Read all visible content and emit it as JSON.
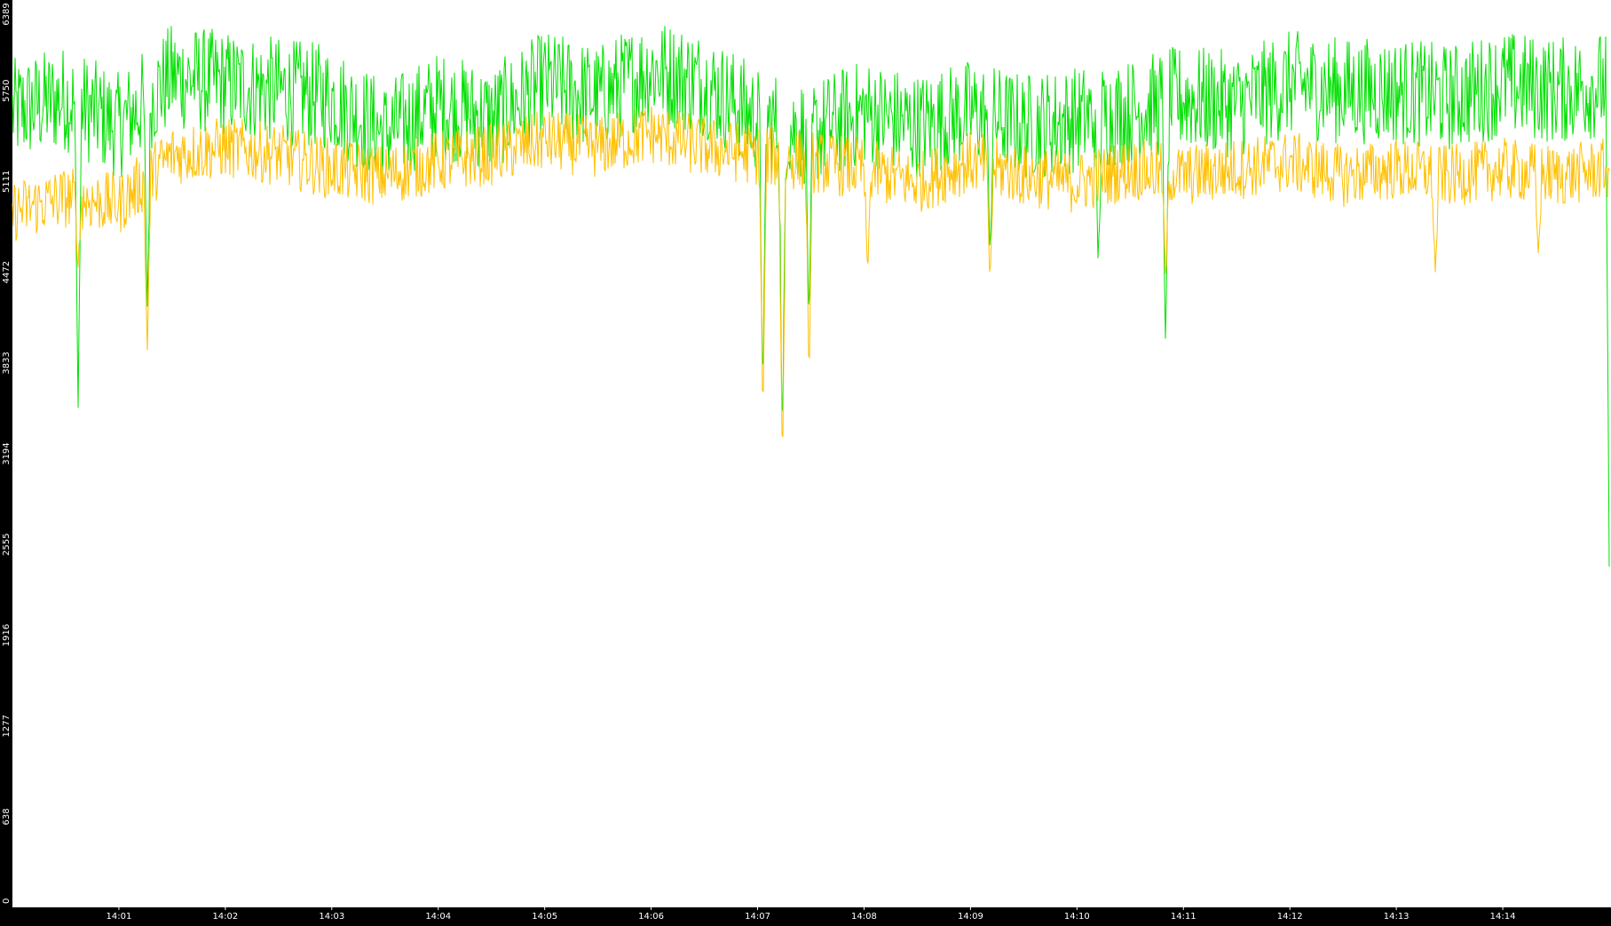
{
  "colors": {
    "background": "#000000",
    "plot_area": "#ffffff",
    "text": "#ffffff",
    "series_green": "#00e000",
    "series_orange": "#ffc000"
  },
  "chart_data": {
    "type": "line",
    "title": "",
    "xlabel": "",
    "ylabel": "",
    "grid": false,
    "legend": "none",
    "ylim": [
      0,
      6389
    ],
    "xlim": [
      "14:00",
      "14:15"
    ],
    "y_ticks": [
      0,
      638,
      1277,
      1916,
      2555,
      3194,
      3833,
      4472,
      5111,
      5750,
      6389
    ],
    "x_ticks": [
      "14:01",
      "14:02",
      "14:03",
      "14:04",
      "14:05",
      "14:06",
      "14:07",
      "14:08",
      "14:09",
      "14:10",
      "14:11",
      "14:12",
      "14:13",
      "14:14"
    ],
    "series": [
      {
        "color": "#00e000",
        "x": [
          "14:00:00",
          "14:00:30",
          "14:01:00",
          "14:01:30",
          "14:02:00",
          "14:02:30",
          "14:03:00",
          "14:03:30",
          "14:04:00",
          "14:04:30",
          "14:05:00",
          "14:05:30",
          "14:06:00",
          "14:06:30",
          "14:07:00",
          "14:07:30",
          "14:08:00",
          "14:08:30",
          "14:09:00",
          "14:09:30",
          "14:10:00",
          "14:10:30",
          "14:11:00",
          "14:11:30",
          "14:12:00",
          "14:12:30",
          "14:13:00",
          "14:13:30",
          "14:14:00",
          "14:14:30",
          "14:15:00"
        ],
        "y": [
          5600,
          5700,
          5500,
          5850,
          5800,
          5750,
          5700,
          5450,
          5650,
          5550,
          5800,
          5700,
          5900,
          5800,
          5550,
          5450,
          5600,
          5500,
          5600,
          5500,
          5550,
          5600,
          5700,
          5650,
          5800,
          5750,
          5750,
          5700,
          5800,
          5750,
          5800
        ]
      },
      {
        "color": "#ffc000",
        "x": [
          "14:00:00",
          "14:00:30",
          "14:01:00",
          "14:01:30",
          "14:02:00",
          "14:02:30",
          "14:03:00",
          "14:03:30",
          "14:04:00",
          "14:04:30",
          "14:05:00",
          "14:05:30",
          "14:06:00",
          "14:06:30",
          "14:07:00",
          "14:07:30",
          "14:08:00",
          "14:08:30",
          "14:09:00",
          "14:09:30",
          "14:10:00",
          "14:10:30",
          "14:11:00",
          "14:11:30",
          "14:12:00",
          "14:12:30",
          "14:13:00",
          "14:13:30",
          "14:14:00",
          "14:14:30",
          "14:15:00"
        ],
        "y": [
          4900,
          5000,
          4950,
          5300,
          5350,
          5300,
          5200,
          5150,
          5250,
          5300,
          5400,
          5350,
          5450,
          5350,
          5300,
          5250,
          5200,
          5100,
          5250,
          5150,
          5100,
          5200,
          5150,
          5200,
          5250,
          5150,
          5200,
          5150,
          5200,
          5150,
          5200
        ]
      }
    ],
    "dips": [
      {
        "series": 0,
        "time": "14:00:37",
        "value": 3500
      },
      {
        "series": 1,
        "time": "14:00:37",
        "value": 4500
      },
      {
        "series": 1,
        "time": "14:01:16",
        "value": 3900
      },
      {
        "series": 0,
        "time": "14:01:16",
        "value": 4200
      },
      {
        "series": 1,
        "time": "14:07:03",
        "value": 3400
      },
      {
        "series": 0,
        "time": "14:07:03",
        "value": 3600
      },
      {
        "series": 1,
        "time": "14:07:14",
        "value": 3050
      },
      {
        "series": 0,
        "time": "14:07:14",
        "value": 3200
      },
      {
        "series": 1,
        "time": "14:07:29",
        "value": 3700
      },
      {
        "series": 0,
        "time": "14:07:29",
        "value": 4100
      },
      {
        "series": 1,
        "time": "14:08:02",
        "value": 4450
      },
      {
        "series": 1,
        "time": "14:09:11",
        "value": 4400
      },
      {
        "series": 0,
        "time": "14:09:11",
        "value": 4600
      },
      {
        "series": 0,
        "time": "14:10:12",
        "value": 4500
      },
      {
        "series": 0,
        "time": "14:10:50",
        "value": 3900
      },
      {
        "series": 1,
        "time": "14:10:50",
        "value": 4400
      },
      {
        "series": 1,
        "time": "14:13:22",
        "value": 4450
      },
      {
        "series": 1,
        "time": "14:14:20",
        "value": 4600
      },
      {
        "series": 0,
        "time": "14:15:00",
        "value": 2400
      }
    ]
  }
}
